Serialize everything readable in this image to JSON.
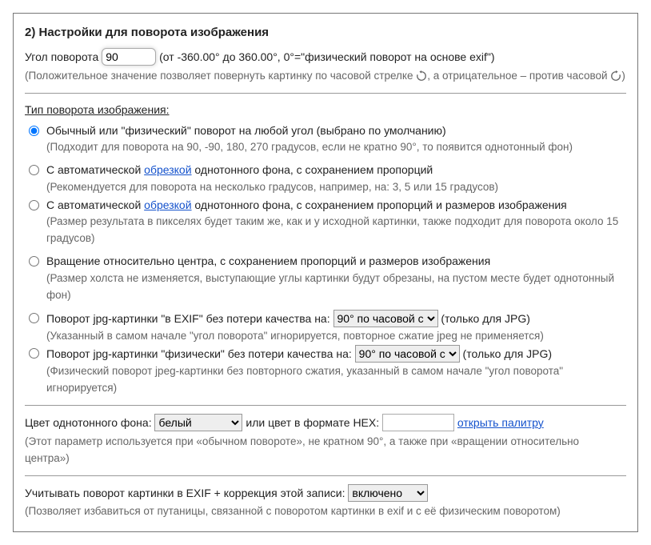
{
  "title": "2) Настройки для поворота изображения",
  "angle": {
    "label_before": "Угол поворота",
    "value": "90",
    "label_after": "(от -360.00° до 360.00°, 0°=\"физический поворот на основе exif\")",
    "hint_pre": "(Положительное значение позволяет повернуть картинку по часовой стрелке ",
    "hint_mid": ", а отрицательное – против часовой ",
    "hint_post": ")"
  },
  "type_label": "Тип поворота изображения:",
  "types": [
    {
      "label": "Обычный или \"физический\" поворот на любой угол (выбрано по умолчанию)",
      "hint": "(Подходит для поворота на 90, -90, 180, 270 градусов, если не кратно 90°, то появится однотонный фон)",
      "checked": true
    },
    {
      "pre": "С автоматической ",
      "link": "обрезкой",
      "post": " однотонного фона, с сохранением пропорций",
      "hint": "(Рекомендуется для поворота на несколько градусов, например, на: 3, 5 или 15 градусов)",
      "checked": false
    },
    {
      "pre": "С автоматической ",
      "link": "обрезкой",
      "post": " однотонного фона, с сохранением пропорций и размеров изображения",
      "hint": "(Размер результата в пикселях будет таким же, как и у исходной картинки, также подходит для поворота около 15 градусов)",
      "checked": false
    },
    {
      "label": "Вращение относительно центра, с сохранением пропорций и размеров изображения",
      "hint": "(Размер холста не изменяется, выступающие углы картинки будут обрезаны, на пустом месте будет однотонный фон)",
      "checked": false
    },
    {
      "label": "Поворот jpg-картинки \"в EXIF\" без потери качества на: ",
      "select_value": "90° по часовой с",
      "suffix": " (только для JPG)",
      "hint": "(Указанный в самом начале \"угол поворота\" игнорируется, повторное сжатие jpeg не применяется)",
      "checked": false
    },
    {
      "label": "Поворот jpg-картинки \"физически\" без потери качества на: ",
      "select_value": "90° по часовой с",
      "suffix": " (только для JPG)",
      "hint": "(Физический поворот jpeg-картинки без повторного сжатия, указанный в самом начале \"угол поворота\" игнорируется)",
      "checked": false
    }
  ],
  "bgcolor": {
    "label": "Цвет однотонного фона:",
    "select_value": "белый",
    "hex_label": "или цвет в формате HEX:",
    "hex_value": "",
    "palette_link": "открыть палитру",
    "hint": "(Этот параметр используется при «обычном повороте», не кратном 90°, а также при «вращении относительно центра»)"
  },
  "exif_correction": {
    "label": "Учитывать поворот картинки в EXIF + коррекция этой записи:",
    "select_value": "включено",
    "hint": "(Позволяет избавиться от путаницы, связанной с поворотом картинки в exif и с её физическим поворотом)"
  }
}
